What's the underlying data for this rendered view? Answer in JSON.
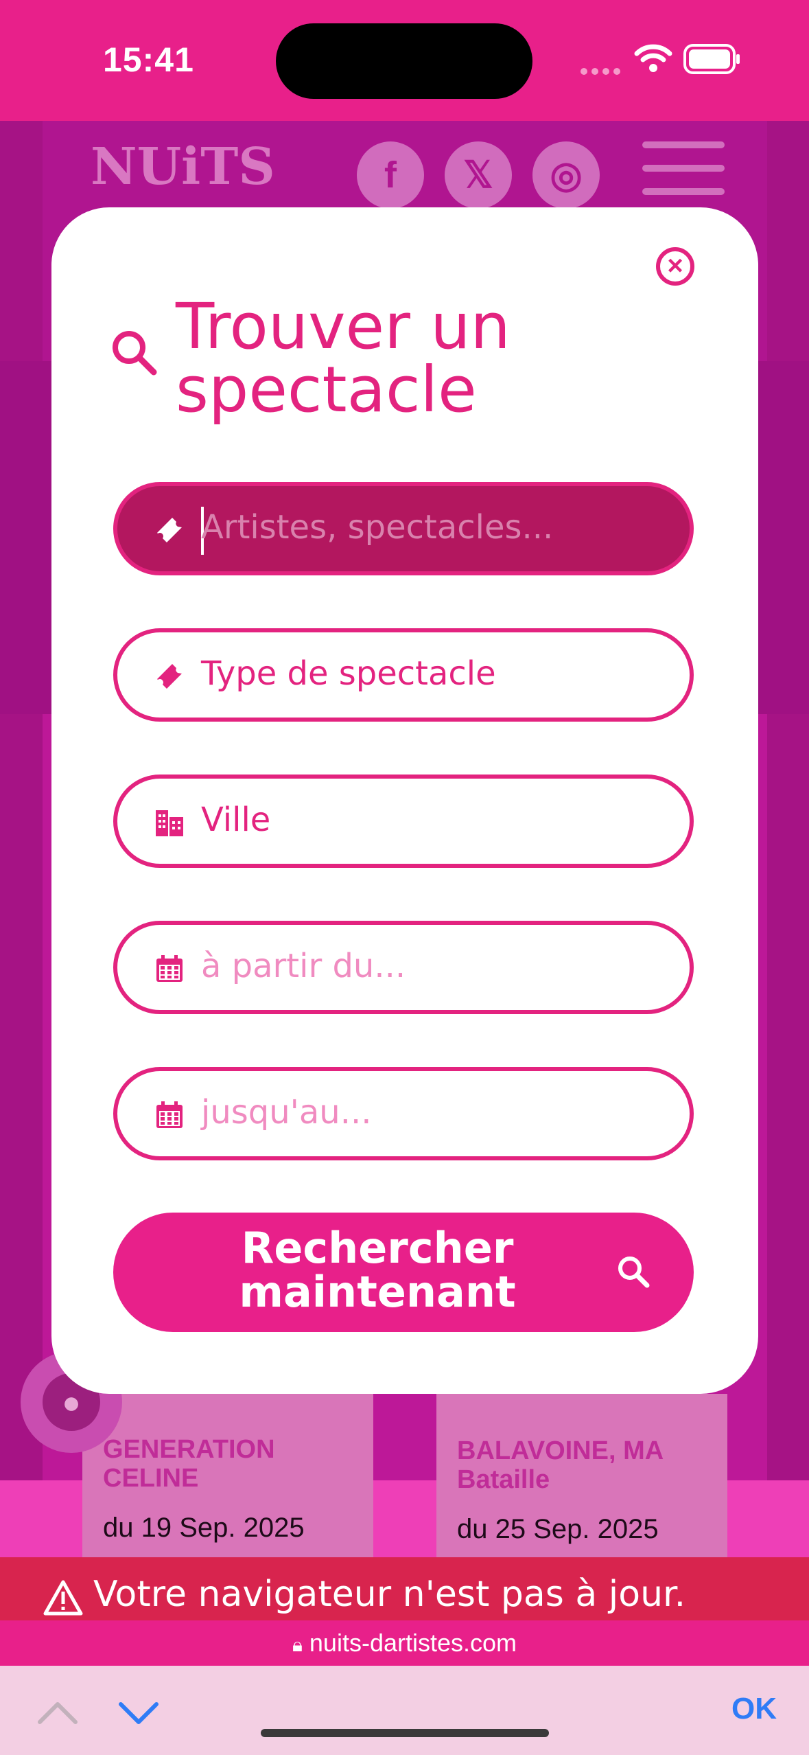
{
  "status_bar": {
    "time": "15:41"
  },
  "background_page": {
    "logo_text": "NUiTS",
    "social_icons": [
      "facebook-icon",
      "x-icon",
      "instagram-icon"
    ],
    "cards": [
      {
        "title": "GENERATION CELINE",
        "date": "du 19 Sep. 2025"
      },
      {
        "title": "BALAVOINE, MA Bataille",
        "date": "du 25 Sep. 2025"
      }
    ]
  },
  "modal": {
    "title": "Trouver un spectacle",
    "fields": [
      {
        "placeholder": "Artistes, spectacles...",
        "icon": "ticket-icon",
        "active": true
      },
      {
        "value": "Type de spectacle",
        "icon": "ticket-icon"
      },
      {
        "value": "Ville",
        "icon": "city-icon"
      },
      {
        "placeholder": "à partir du...",
        "icon": "calendar-icon"
      },
      {
        "placeholder": "jusqu'au...",
        "icon": "calendar-icon"
      }
    ],
    "search_button": "Rechercher maintenant"
  },
  "browser": {
    "warning": "Votre navigateur n'est pas à jour.",
    "url": "nuits-dartistes.com",
    "done_label": "OK"
  },
  "colors": {
    "accent": "#e3237f",
    "warning": "#d8244e",
    "link": "#2f7cf6"
  }
}
